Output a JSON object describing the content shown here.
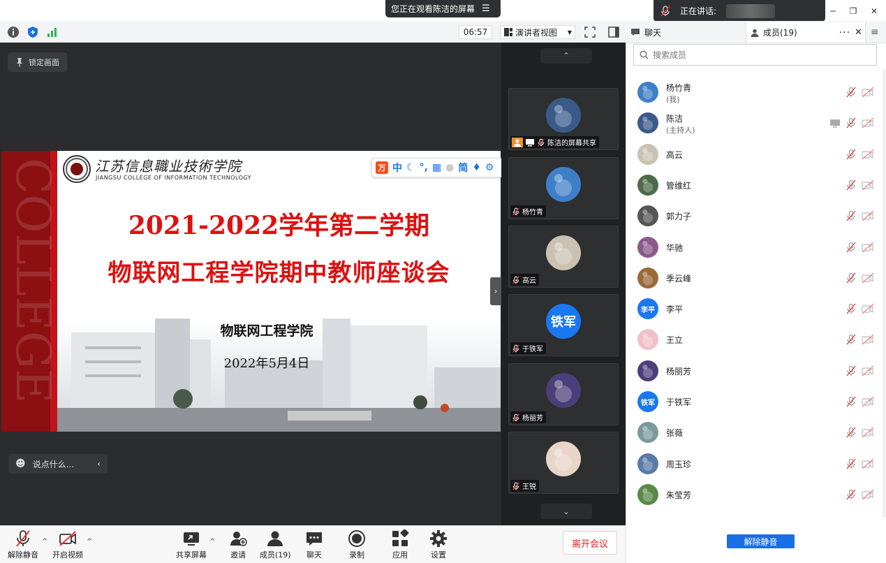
{
  "title_strip": {
    "sharing_notice": "您正在观看陈洁的屏幕",
    "speaking_label": "正在讲话:"
  },
  "toolbar": {
    "clock": "06:57",
    "view_mode": "演讲者视图"
  },
  "stage": {
    "lock_label": "锁定画面",
    "chat_placeholder": "说点什么..."
  },
  "slide": {
    "school_cn": "江苏信息職业技術学院",
    "school_en": "JIANGSU COLLEGE OF INFORMATION TECHNOLOGY",
    "title_line1": "2021-2022学年第二学期",
    "title_line2": "物联网工程学院期中教师座谈会",
    "organizer": "物联网工程学院",
    "date": "2022年5月4日",
    "ime_bar": {
      "logo": "万",
      "items": [
        "中",
        "简"
      ]
    }
  },
  "gallery": [
    {
      "name": "陈洁的屏幕共享",
      "avatar": "mountain",
      "color": "#3a5a8a"
    },
    {
      "name": "杨竹青",
      "avatar": "windmill",
      "color": "#3f7fc8"
    },
    {
      "name": "高云",
      "avatar": "kids",
      "color": "#c9c2b2"
    },
    {
      "name": "于铁军",
      "avatar": "text",
      "avatar_text": "铁军",
      "color": "#1a78f0"
    },
    {
      "name": "杨丽芳",
      "avatar": "flower",
      "color": "#4b3f7a"
    },
    {
      "name": "王锐",
      "avatar": "baby",
      "color": "#e8d5c8"
    }
  ],
  "bottom_bar": {
    "unmute": "解除静音",
    "start_video": "开启视频",
    "share_screen": "共享屏幕",
    "invite": "邀请",
    "members": "成员(19)",
    "chat": "聊天",
    "record": "录制",
    "apps": "应用",
    "settings": "设置",
    "leave": "离开会议"
  },
  "right_panel": {
    "tab_chat": "聊天",
    "tab_members": "成员(19)",
    "search_placeholder": "搜索成员",
    "unmute_all": "解除静音",
    "members": [
      {
        "name": "杨竹青",
        "role": "(我)",
        "color": "#3f7fc8",
        "screen": false
      },
      {
        "name": "陈洁",
        "role": "(主持人)",
        "color": "#3a5a8a",
        "screen": true
      },
      {
        "name": "高云",
        "role": "",
        "color": "#c9c2b2",
        "screen": false
      },
      {
        "name": "管维红",
        "role": "",
        "color": "#4d6b4a",
        "screen": false
      },
      {
        "name": "郭力子",
        "role": "",
        "color": "#555555",
        "screen": false
      },
      {
        "name": "华驰",
        "role": "",
        "color": "#8a5a8a",
        "screen": false
      },
      {
        "name": "季云峰",
        "role": "",
        "color": "#9a6a3a",
        "screen": false
      },
      {
        "name": "李平",
        "role": "",
        "color": "#1a78f0",
        "screen": false,
        "avatar_text": "李平"
      },
      {
        "name": "王立",
        "role": "",
        "color": "#f0c0c8",
        "screen": false
      },
      {
        "name": "杨丽芳",
        "role": "",
        "color": "#4b3f7a",
        "screen": false
      },
      {
        "name": "于铁军",
        "role": "",
        "color": "#1a78f0",
        "screen": false,
        "avatar_text": "铁军"
      },
      {
        "name": "张薇",
        "role": "",
        "color": "#7a9a9a",
        "screen": false
      },
      {
        "name": "周玉珍",
        "role": "",
        "color": "#5a7aa8",
        "screen": false
      },
      {
        "name": "朱莹芳",
        "role": "",
        "color": "#5a8a4a",
        "screen": false
      }
    ]
  }
}
